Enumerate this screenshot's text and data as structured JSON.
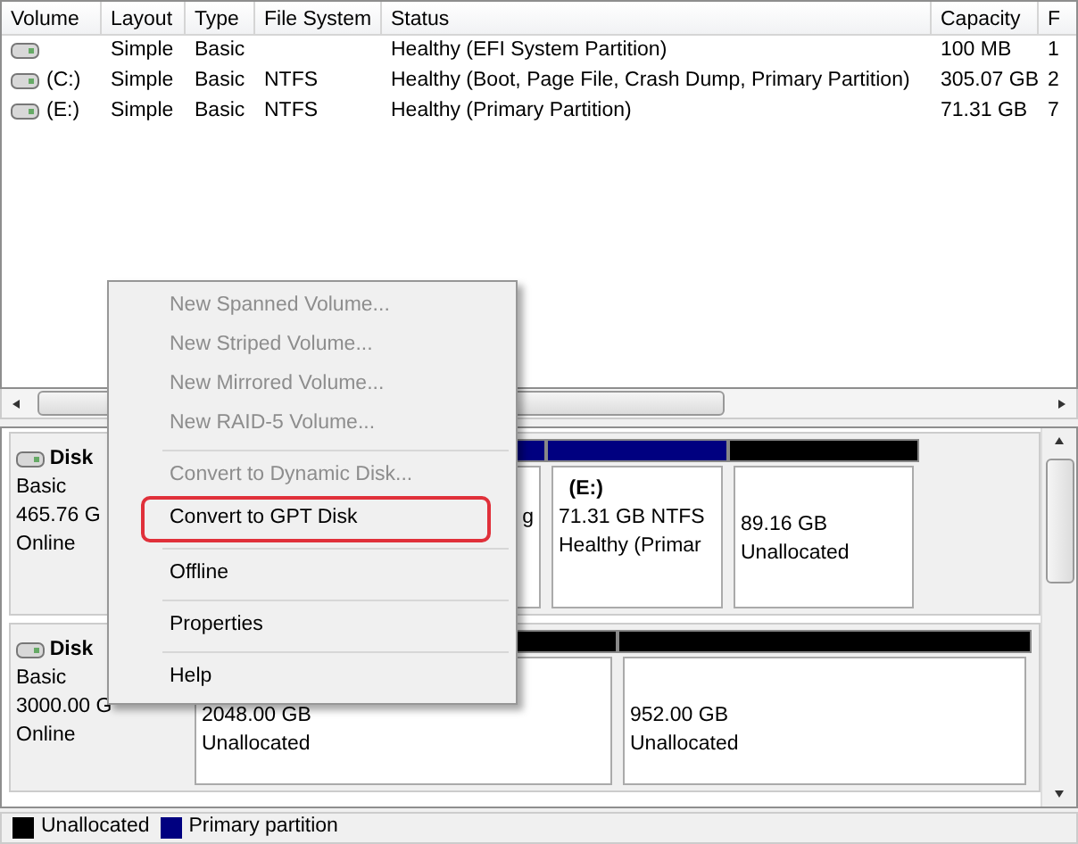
{
  "volume_list": {
    "columns": [
      "Volume",
      "Layout",
      "Type",
      "File System",
      "Status",
      "Capacity",
      "F"
    ],
    "rows": [
      {
        "cells": [
          null,
          "Simple",
          "Basic",
          null,
          "Healthy (EFI System Partition)",
          "100 MB",
          "1"
        ]
      },
      {
        "cells": [
          "(C:)",
          "Simple",
          "Basic",
          "NTFS",
          "Healthy (Boot, Page File, Crash Dump, Primary Partition)",
          "305.07 GB",
          "2"
        ]
      },
      {
        "cells": [
          "(E:)",
          "Simple",
          "Basic",
          "NTFS",
          "Healthy (Primary Partition)",
          "71.31 GB",
          "7"
        ]
      }
    ]
  },
  "disks": [
    {
      "name": "Disk",
      "type": "Basic",
      "size": "465.76 G",
      "status": "Online",
      "partitions": [
        {
          "kind": "primary",
          "lines": [
            "g"
          ]
        },
        {
          "kind": "primary",
          "title": "(E:)",
          "lines": [
            "71.31 GB NTFS",
            "Healthy (Primar"
          ]
        },
        {
          "kind": "unallocated",
          "lines": [
            "89.16 GB",
            "Unallocated"
          ]
        }
      ]
    },
    {
      "name": "Disk",
      "type": "Basic",
      "size": "3000.00 G",
      "status": "Online",
      "partitions": [
        {
          "kind": "unallocated",
          "lines": [
            "2048.00 GB",
            "Unallocated"
          ]
        },
        {
          "kind": "unallocated",
          "lines": [
            "952.00 GB",
            "Unallocated"
          ]
        }
      ]
    }
  ],
  "legend": [
    {
      "label": "Unallocated",
      "color": "#000000"
    },
    {
      "label": "Primary partition",
      "color": "#000080"
    }
  ],
  "context_menu": {
    "groups": [
      [
        {
          "label": "New Spanned Volume...",
          "disabled": true
        },
        {
          "label": "New Striped Volume...",
          "disabled": true
        },
        {
          "label": "New Mirrored Volume...",
          "disabled": true
        },
        {
          "label": "New RAID-5 Volume...",
          "disabled": true
        }
      ],
      [
        {
          "label": "Convert to Dynamic Disk...",
          "disabled": true
        },
        {
          "label": "Convert to GPT Disk",
          "disabled": false,
          "outlined": true
        }
      ],
      [
        {
          "label": "Offline",
          "disabled": false
        }
      ],
      [
        {
          "label": "Properties",
          "disabled": false
        }
      ],
      [
        {
          "label": "Help",
          "disabled": false
        }
      ]
    ]
  }
}
